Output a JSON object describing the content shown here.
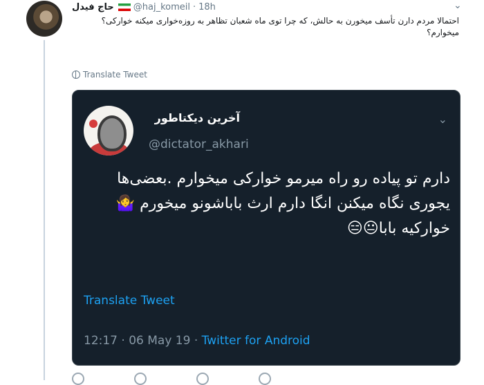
{
  "tweet": {
    "display_name": "حاج فیدل",
    "handle": "@haj_komeil",
    "time": "18h",
    "separator": "·",
    "text": "احتمالا مردم دارن تأسف میخورن به حالش، که چرا توی ماه شعبان تظاهر به روزه‌خواری میکنه خوارکی؟ میخوارم؟",
    "translate_label": "Translate Tweet"
  },
  "quoted": {
    "display_name": "آخرین دیکتاطور",
    "handle": "@dictator_akhari",
    "text": "دارم تو پیاده رو راه میرمو خوارکی میخوارم .بعضی‌ها یجوری نگاه میکنن انگا دارم ارث باباشونو میخورم 🤷‍♀️ خوارکیه بابا😐😑",
    "translate_label": "Translate Tweet",
    "time": "12:17",
    "date": "06 May 19",
    "meta_separator": "·",
    "client": "Twitter for Android"
  },
  "icons": {
    "avatar": "user-avatar-photo",
    "flag": "iran-flag-icon",
    "globe": "globe-icon",
    "chevron": "chevron-down-icon"
  }
}
